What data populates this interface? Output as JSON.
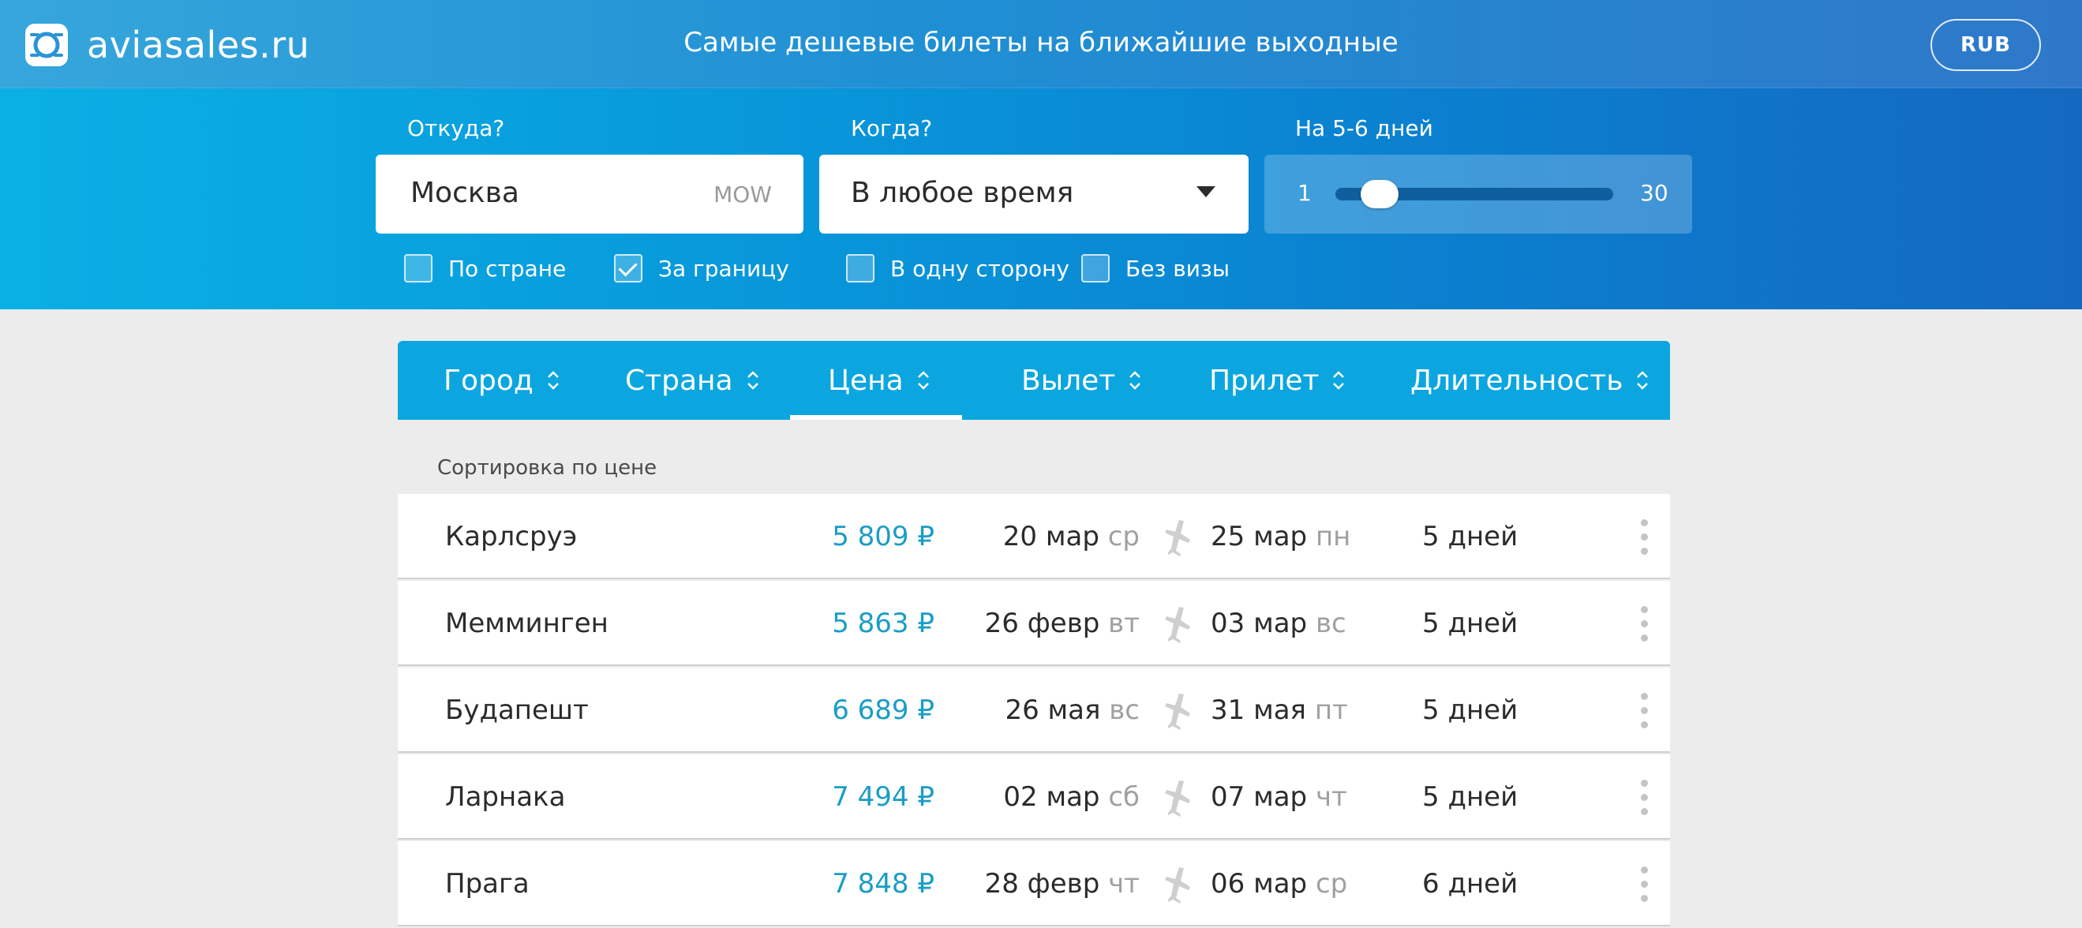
{
  "header": {
    "brand": "aviasales.ru",
    "tagline": "Самые дешевые билеты на ближайшие выходные",
    "currency": "RUB"
  },
  "search": {
    "from_label": "Откуда?",
    "from_value": "Москва",
    "from_code": "MOW",
    "when_label": "Когда?",
    "when_value": "В любое время",
    "duration_label": "На 5-6 дней",
    "duration_min": "1",
    "duration_max": "30",
    "duration_selected": [
      5,
      6
    ],
    "filters": [
      {
        "label": "По стране",
        "checked": false
      },
      {
        "label": "За границу",
        "checked": true
      },
      {
        "label": "В одну сторону",
        "checked": false
      },
      {
        "label": "Без визы",
        "checked": false
      }
    ]
  },
  "sort": {
    "tabs": [
      "Город",
      "Страна",
      "Цена",
      "Вылет",
      "Прилет",
      "Длительность"
    ],
    "active": "Цена",
    "caption": "Сортировка по цене"
  },
  "results": [
    {
      "city": "Карлсруэ",
      "price": "5 809 ₽",
      "dep_date": "20 мар",
      "dep_day": "ср",
      "arr_date": "25 мар",
      "arr_day": "пн",
      "duration": "5 дней"
    },
    {
      "city": "Мемминген",
      "price": "5 863 ₽",
      "dep_date": "26 февр",
      "dep_day": "вт",
      "arr_date": "03 мар",
      "arr_day": "вс",
      "duration": "5 дней"
    },
    {
      "city": "Будапешт",
      "price": "6 689 ₽",
      "dep_date": "26 мая",
      "dep_day": "вс",
      "arr_date": "31 мая",
      "arr_day": "пт",
      "duration": "5 дней"
    },
    {
      "city": "Ларнака",
      "price": "7 494 ₽",
      "dep_date": "02 мар",
      "dep_day": "сб",
      "arr_date": "07 мар",
      "arr_day": "чт",
      "duration": "5 дней"
    },
    {
      "city": "Прага",
      "price": "7 848 ₽",
      "dep_date": "28 февр",
      "dep_day": "чт",
      "arr_date": "06 мар",
      "arr_day": "ср",
      "duration": "6 дней"
    }
  ],
  "icons": {
    "logo": "aviasales-logo-icon",
    "dropdown": "chevron-down-icon",
    "sort": "sort-updown-icon",
    "plane": "plane-icon",
    "more": "more-vertical-icon"
  },
  "colors": {
    "header_bg": "#2a94d6",
    "search_bg": "#0899db",
    "sortbar_bg": "#0ba6df",
    "price": "#1a9dc6",
    "page_bg": "#ececec"
  }
}
